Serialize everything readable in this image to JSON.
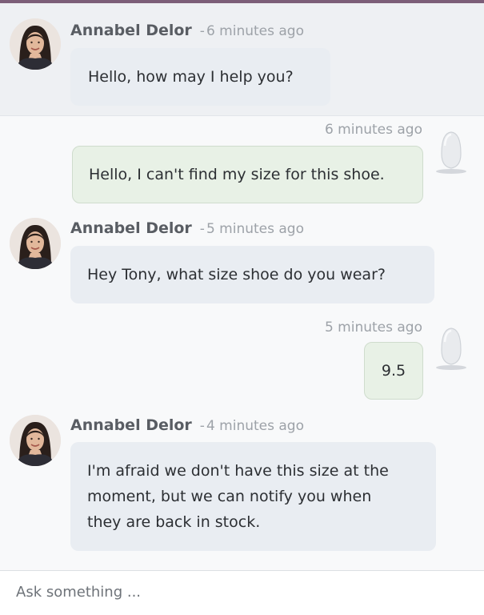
{
  "agent": {
    "name": "Annabel Delor"
  },
  "messages": [
    {
      "role": "agent",
      "author": "Annabel Delor",
      "time": "6 minutes ago",
      "text": "Hello, how may I help you?"
    },
    {
      "role": "user",
      "time": "6 minutes ago",
      "text": "Hello, I can't find my size for this shoe."
    },
    {
      "role": "agent",
      "author": "Annabel Delor",
      "time": "5 minutes ago",
      "text": "Hey Tony, what size shoe do you wear?"
    },
    {
      "role": "user",
      "time": "5 minutes ago",
      "text": "9.5"
    },
    {
      "role": "agent",
      "author": "Annabel Delor",
      "time": "4 minutes ago",
      "lines": [
        "I'm afraid we don't have this size at the",
        "moment, but we can notify you when",
        "they are back in stock."
      ]
    }
  ],
  "composer": {
    "placeholder": "Ask something ..."
  },
  "colors": {
    "accent_border": "#7c5e78",
    "agent_bubble": "#e9edf2",
    "user_bubble": "#e8f1e6",
    "user_bubble_border": "#cfdccd",
    "author_name": "#595d63",
    "timestamp": "#9da2a8"
  }
}
